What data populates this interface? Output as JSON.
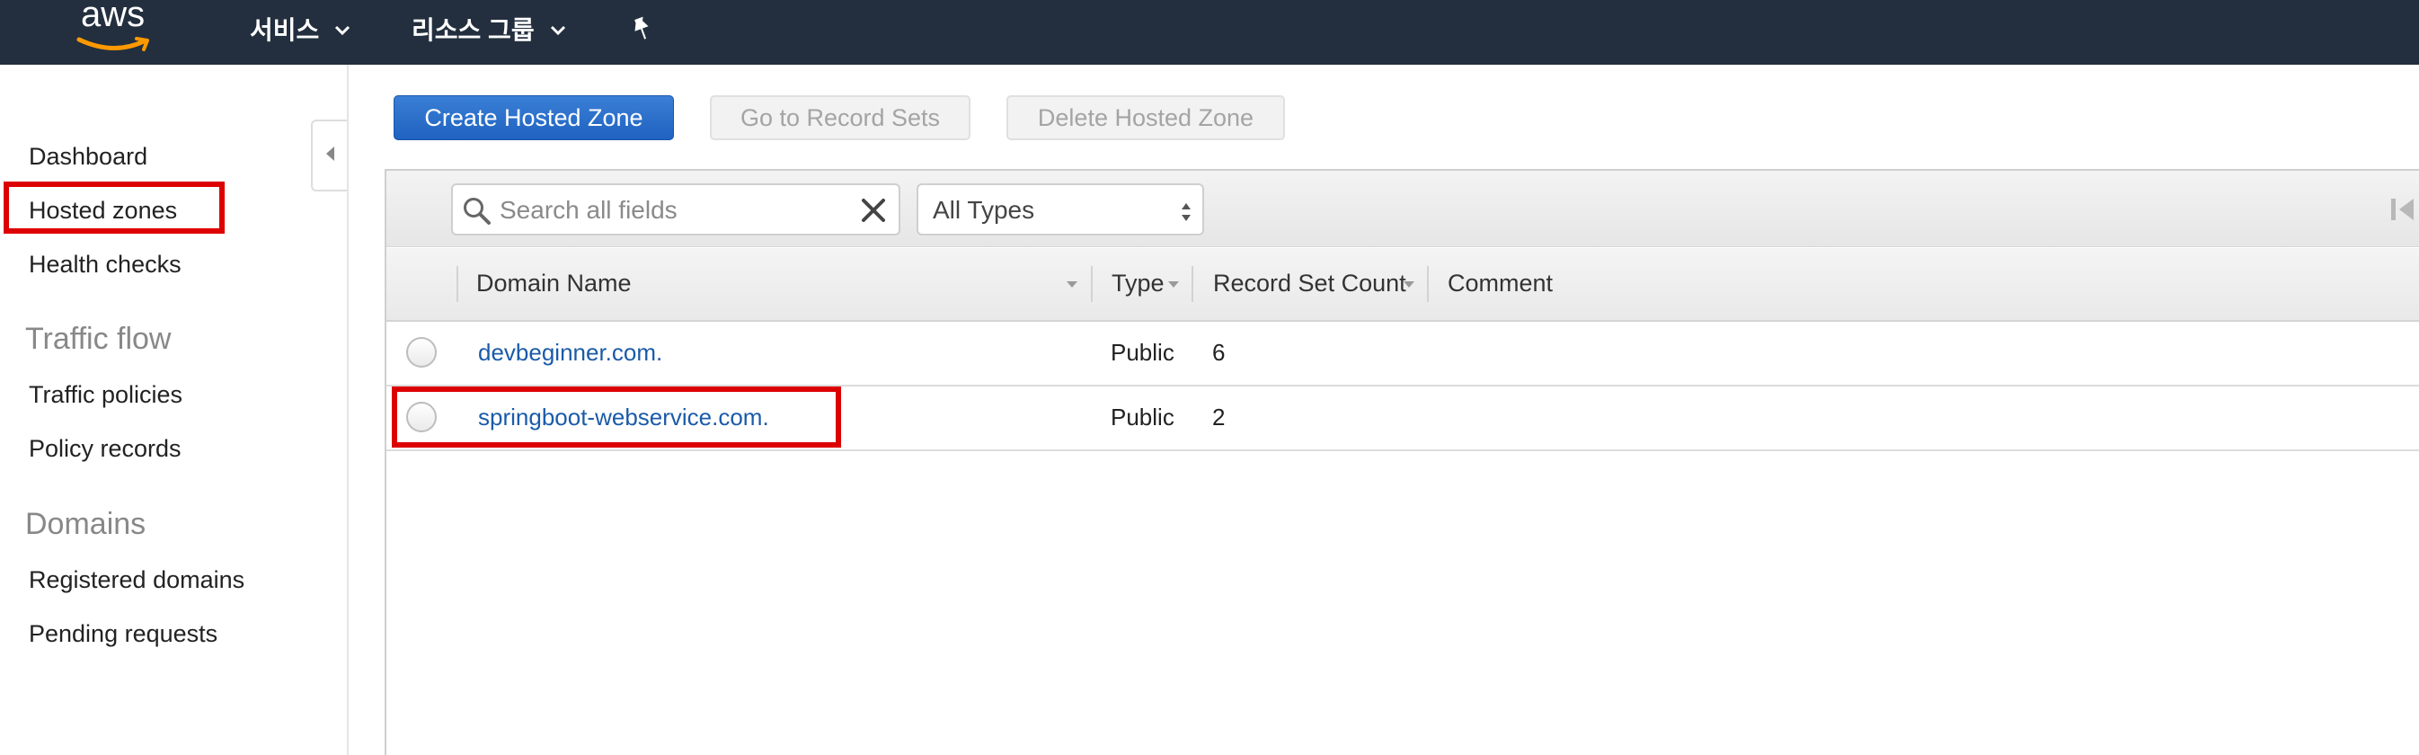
{
  "topnav": {
    "logo_text": "aws",
    "services_label": "서비스",
    "resource_groups_label": "리소스 그룹",
    "bg_color": "#232f3e"
  },
  "sidebar": {
    "items": [
      {
        "label": "Dashboard"
      },
      {
        "label": "Hosted zones",
        "highlighted": true
      },
      {
        "label": "Health checks"
      }
    ],
    "traffic_flow": {
      "heading": "Traffic flow",
      "items": [
        {
          "label": "Traffic policies"
        },
        {
          "label": "Policy records"
        }
      ]
    },
    "domains": {
      "heading": "Domains",
      "items": [
        {
          "label": "Registered domains"
        },
        {
          "label": "Pending requests"
        }
      ]
    }
  },
  "toolbar": {
    "create_label": "Create Hosted Zone",
    "goto_label": "Go to Record Sets",
    "delete_label": "Delete Hosted Zone"
  },
  "filter": {
    "search_placeholder": "Search all fields",
    "type_selected": "All Types"
  },
  "table": {
    "columns": [
      "Domain Name",
      "Type",
      "Record Set Count",
      "Comment"
    ],
    "rows": [
      {
        "domain": "devbeginner.com.",
        "type": "Public",
        "count": "6",
        "comment": ""
      },
      {
        "domain": "springboot-webservice.com.",
        "type": "Public",
        "count": "2",
        "comment": "",
        "highlighted": true
      }
    ]
  },
  "colors": {
    "primary_button": "#1f62c1",
    "link": "#1a5ba8",
    "highlight_box": "#dd0000"
  }
}
